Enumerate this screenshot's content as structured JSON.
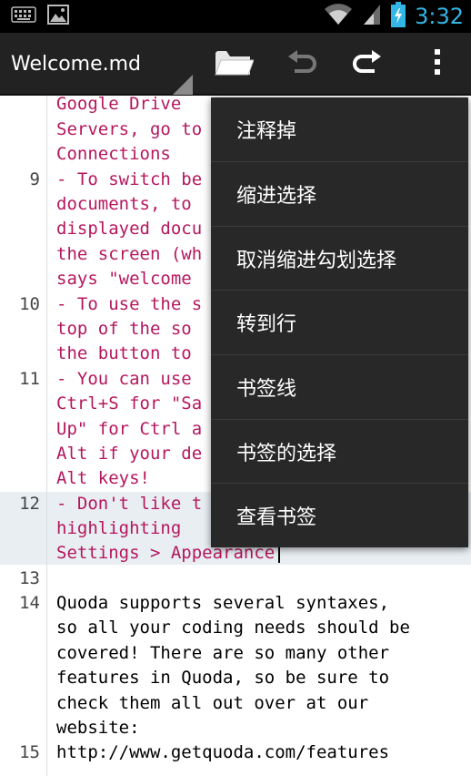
{
  "status_bar": {
    "time": "3:32",
    "icons": [
      "keyboard-icon",
      "image-icon",
      "wifi-icon",
      "signal-icon",
      "battery-charging-icon"
    ],
    "time_color": "#33b5e5"
  },
  "action_bar": {
    "title": "Welcome.md",
    "buttons": [
      "folder-icon",
      "undo-icon",
      "redo-icon",
      "overflow-menu-icon"
    ]
  },
  "editor": {
    "lines": [
      {
        "num": "",
        "text": "Google Drive",
        "style": "pink"
      },
      {
        "num": "",
        "text": "Servers, go to",
        "style": "pink"
      },
      {
        "num": "",
        "text": "Connections",
        "style": "pink"
      },
      {
        "num": "9",
        "text": "- To switch be",
        "style": "pink"
      },
      {
        "num": "",
        "text": "documents, to",
        "style": "pink"
      },
      {
        "num": "",
        "text": "displayed docu",
        "style": "pink"
      },
      {
        "num": "",
        "text": "the screen (wh",
        "style": "pink"
      },
      {
        "num": "",
        "text": "says \"welcome",
        "style": "pink"
      },
      {
        "num": "10",
        "text": "- To use the s",
        "style": "pink"
      },
      {
        "num": "",
        "text": "top of the so",
        "style": "pink"
      },
      {
        "num": "",
        "text": "the button to",
        "style": "pink"
      },
      {
        "num": "11",
        "text": "- You can use",
        "style": "pink"
      },
      {
        "num": "",
        "text": "Ctrl+S for \"Sa",
        "style": "pink"
      },
      {
        "num": "",
        "text": "Up\" for Ctrl a",
        "style": "pink"
      },
      {
        "num": "",
        "text": "Alt if your de",
        "style": "pink"
      },
      {
        "num": "",
        "text": "Alt keys!",
        "style": "pink"
      },
      {
        "num": "12",
        "text": "- Don't like t",
        "style": "pink"
      },
      {
        "num": "",
        "text": "highlighting",
        "style": "pink"
      },
      {
        "num": "",
        "text": "Settings > Appearance",
        "style": "pink"
      },
      {
        "num": "13",
        "text": "",
        "style": "black"
      },
      {
        "num": "14",
        "text": "Quoda supports several syntaxes,",
        "style": "black"
      },
      {
        "num": "",
        "text": "so all your coding needs should be",
        "style": "black"
      },
      {
        "num": "",
        "text": "covered! There are so many other",
        "style": "black"
      },
      {
        "num": "",
        "text": "features in Quoda, so be sure to",
        "style": "black"
      },
      {
        "num": "",
        "text": "check them all out over at our",
        "style": "black"
      },
      {
        "num": "",
        "text": "website:",
        "style": "black"
      },
      {
        "num": "15",
        "text": "http://www.getquoda.com/features",
        "style": "black"
      }
    ]
  },
  "menu": {
    "items": [
      {
        "label": "注释掉"
      },
      {
        "label": "缩进选择"
      },
      {
        "label": "取消缩进勾划选择"
      },
      {
        "label": "转到行"
      },
      {
        "label": "书签线"
      },
      {
        "label": "书签的选择"
      },
      {
        "label": "查看书签"
      }
    ]
  }
}
